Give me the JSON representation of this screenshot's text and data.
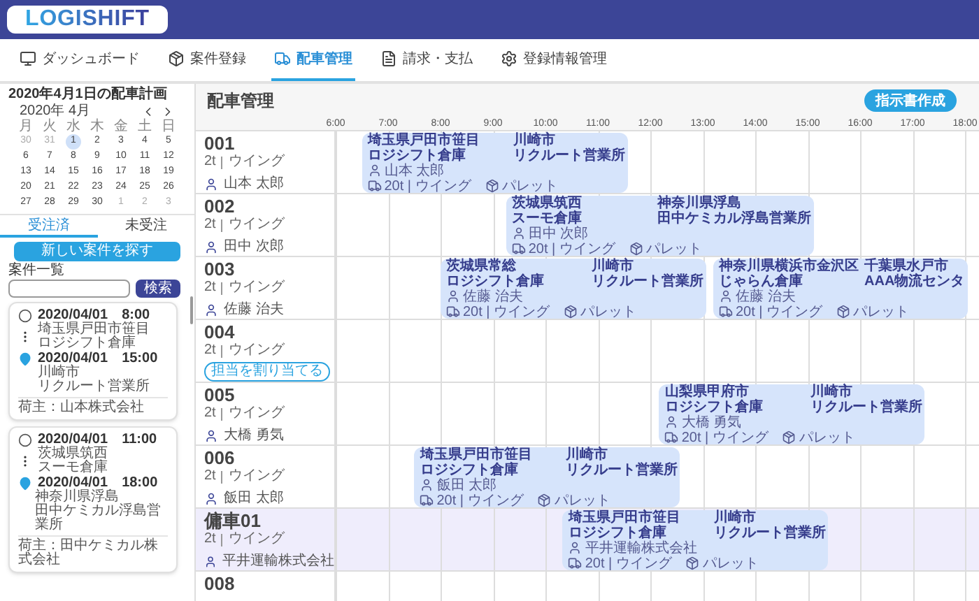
{
  "app": {
    "logo": "LOGISHIFT"
  },
  "nav": [
    {
      "label": "ダッシュボード",
      "selected": false
    },
    {
      "label": "案件登録",
      "selected": false
    },
    {
      "label": "配車管理",
      "selected": true
    },
    {
      "label": "請求・支払",
      "selected": false
    },
    {
      "label": "登録情報管理",
      "selected": false
    }
  ],
  "sidebar": {
    "title": "2020年4月1日の配車計画",
    "calendar": {
      "month": "2020年 4月",
      "weekdays": [
        "月",
        "火",
        "水",
        "木",
        "金",
        "土",
        "日"
      ],
      "days": [
        {
          "label": "30",
          "outside": true,
          "selected": false
        },
        {
          "label": "31",
          "outside": true,
          "selected": false
        },
        {
          "label": "1",
          "outside": false,
          "selected": true
        },
        {
          "label": "2",
          "outside": false,
          "selected": false
        },
        {
          "label": "3",
          "outside": false,
          "selected": false
        },
        {
          "label": "4",
          "outside": false,
          "selected": false
        },
        {
          "label": "5",
          "outside": false,
          "selected": false
        },
        {
          "label": "6",
          "outside": false,
          "selected": false
        },
        {
          "label": "7",
          "outside": false,
          "selected": false
        },
        {
          "label": "8",
          "outside": false,
          "selected": false
        },
        {
          "label": "9",
          "outside": false,
          "selected": false
        },
        {
          "label": "10",
          "outside": false,
          "selected": false
        },
        {
          "label": "11",
          "outside": false,
          "selected": false
        },
        {
          "label": "12",
          "outside": false,
          "selected": false
        },
        {
          "label": "13",
          "outside": false,
          "selected": false
        },
        {
          "label": "14",
          "outside": false,
          "selected": false
        },
        {
          "label": "15",
          "outside": false,
          "selected": false
        },
        {
          "label": "16",
          "outside": false,
          "selected": false
        },
        {
          "label": "17",
          "outside": false,
          "selected": false
        },
        {
          "label": "18",
          "outside": false,
          "selected": false
        },
        {
          "label": "19",
          "outside": false,
          "selected": false
        },
        {
          "label": "20",
          "outside": false,
          "selected": false
        },
        {
          "label": "21",
          "outside": false,
          "selected": false
        },
        {
          "label": "22",
          "outside": false,
          "selected": false
        },
        {
          "label": "23",
          "outside": false,
          "selected": false
        },
        {
          "label": "24",
          "outside": false,
          "selected": false
        },
        {
          "label": "25",
          "outside": false,
          "selected": false
        },
        {
          "label": "26",
          "outside": false,
          "selected": false
        },
        {
          "label": "27",
          "outside": false,
          "selected": false
        },
        {
          "label": "28",
          "outside": false,
          "selected": false
        },
        {
          "label": "29",
          "outside": false,
          "selected": false
        },
        {
          "label": "30",
          "outside": false,
          "selected": false
        },
        {
          "label": "1",
          "outside": true,
          "selected": false
        },
        {
          "label": "2",
          "outside": true,
          "selected": false
        },
        {
          "label": "3",
          "outside": true,
          "selected": false
        }
      ]
    },
    "tabs": [
      {
        "label": "受注済",
        "selected": true
      },
      {
        "label": "未受注",
        "selected": false
      }
    ],
    "new_case_button": "新しい案件を探す",
    "case_list": {
      "label": "案件一覧",
      "search_button": "検索",
      "cards": [
        {
          "pickup": {
            "date": "2020/04/01",
            "time": "8:00",
            "address": [
              "埼玉県戸田市笹目",
              "ロジシフト倉庫"
            ]
          },
          "delivery": {
            "date": "2020/04/01",
            "time": "15:00",
            "address": [
              "川崎市",
              "リクルート営業所"
            ]
          },
          "shipper": "荷主：山本株式会社"
        },
        {
          "pickup": {
            "date": "2020/04/01",
            "time": "11:00",
            "address": [
              "茨城県筑西",
              "スーモ倉庫"
            ]
          },
          "delivery": {
            "date": "2020/04/01",
            "time": "18:00",
            "address": [
              "神奈川県浮島",
              "田中ケミカル浮島営業所"
            ]
          },
          "shipper": "荷主：田中ケミカル株式会社"
        }
      ]
    }
  },
  "schedule": {
    "title": "配車管理",
    "create_button": "指示書作成",
    "hours": [
      "6:00",
      "7:00",
      "8:00",
      "9:00",
      "10:00",
      "11:00",
      "12:00",
      "13:00",
      "14:00",
      "15:00",
      "16:00",
      "17:00",
      "18:00"
    ],
    "vehicles": [
      {
        "name": "001",
        "capacity": "2t",
        "body": "ウイング",
        "kind": "driver",
        "driver": "山本 太郎",
        "chartered": false,
        "jobs": [
          {
            "from": [
              "埼玉県戸田市笹目",
              "ロジシフト倉庫"
            ],
            "to": [
              "川崎市",
              "リクルート営業所"
            ],
            "driver": "山本 太郎",
            "truck": "20t | ウイング",
            "cargo": "パレット"
          }
        ]
      },
      {
        "name": "002",
        "capacity": "2t",
        "body": "ウイング",
        "kind": "driver",
        "driver": "田中 次郎",
        "chartered": false,
        "jobs": [
          {
            "from": [
              "茨城県筑西",
              "スーモ倉庫"
            ],
            "to": [
              "神奈川県浮島",
              "田中ケミカル浮島営業所"
            ],
            "driver": "田中 次郎",
            "truck": "20t | ウイング",
            "cargo": "パレット"
          }
        ]
      },
      {
        "name": "003",
        "capacity": "2t",
        "body": "ウイング",
        "kind": "driver",
        "driver": "佐藤 治夫",
        "chartered": false,
        "jobs": [
          {
            "from": [
              "茨城県常総",
              "ロジシフト倉庫"
            ],
            "to": [
              "川崎市",
              "リクルート営業所"
            ],
            "driver": "佐藤 治夫",
            "truck": "20t | ウイング",
            "cargo": "パレット"
          },
          {
            "from": [
              "神奈川県横浜市金沢区",
              "じゃらん倉庫"
            ],
            "to": [
              "千葉県水戸市",
              "AAA物流センタ"
            ],
            "driver": "佐藤 治夫",
            "truck": "20t | ウイング",
            "cargo": "パレット"
          }
        ]
      },
      {
        "name": "004",
        "capacity": "2t",
        "body": "ウイング",
        "kind": "assign",
        "assign_button": "担当を割り当てる",
        "chartered": false
      },
      {
        "name": "005",
        "capacity": "2t",
        "body": "ウイング",
        "kind": "driver",
        "driver": "大橋 勇気",
        "chartered": false,
        "jobs": [
          {
            "from": [
              "山梨県甲府市",
              "ロジシフト倉庫"
            ],
            "to": [
              "川崎市",
              "リクルート営業所"
            ],
            "driver": "大橋 勇気",
            "truck": "20t | ウイング",
            "cargo": "パレット"
          }
        ]
      },
      {
        "name": "006",
        "capacity": "2t",
        "body": "ウイング",
        "kind": "driver",
        "driver": "飯田 太郎",
        "chartered": false,
        "jobs": [
          {
            "from": [
              "埼玉県戸田市笹目",
              "ロジシフト倉庫"
            ],
            "to": [
              "川崎市",
              "リクルート営業所"
            ],
            "driver": "飯田 太郎",
            "truck": "20t | ウイング",
            "cargo": "パレット"
          }
        ]
      },
      {
        "name": "傭車01",
        "capacity": "2t",
        "body": "ウイング",
        "kind": "driver",
        "driver": "平井運輸株式会社",
        "chartered": true,
        "jobs": [
          {
            "from": [
              "埼玉県戸田市笹目",
              "ロジシフト倉庫"
            ],
            "to": [
              "川崎市",
              "リクルート営業所"
            ],
            "driver": "平井運輸株式会社",
            "truck": "20t | ウイング",
            "cargo": "パレット"
          }
        ]
      },
      {
        "name": "008",
        "kind": "name",
        "chartered": false
      }
    ]
  }
}
